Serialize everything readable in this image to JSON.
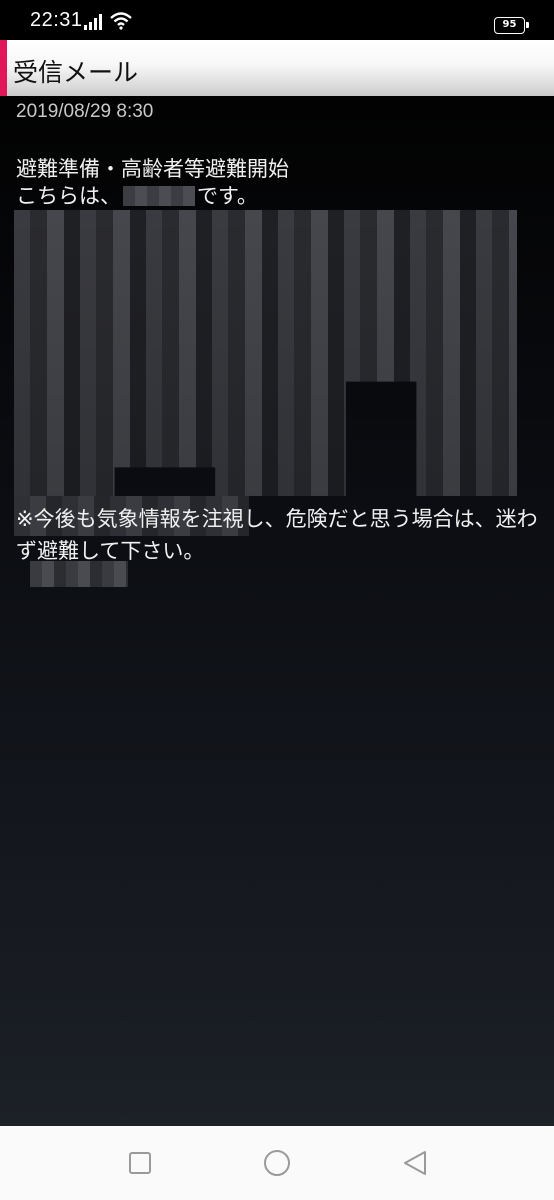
{
  "status_bar": {
    "time": "22:31",
    "battery": "95",
    "icons": [
      "signal-icon",
      "wifi-icon",
      "battery-icon"
    ]
  },
  "header": {
    "title": "受信メール",
    "accent_color": "#e0185a"
  },
  "mail": {
    "date": "2019/08/29 8:30",
    "subject": "避難準備・高齢者等避難開始",
    "line1_prefix": "こちらは、",
    "line1_suffix": "です。",
    "notice": "※今後も気象情報を注視し、危険だと思う場合は、迷わず避難して下さい。"
  },
  "nav_bar": {
    "buttons": [
      "recent-apps-icon",
      "home-icon",
      "back-icon"
    ]
  }
}
